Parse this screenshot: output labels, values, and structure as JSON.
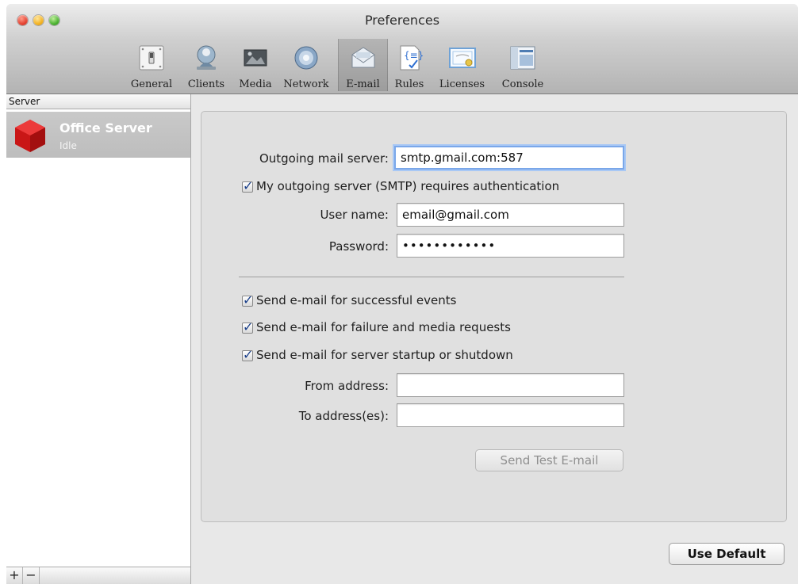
{
  "window": {
    "title": "Preferences"
  },
  "toolbar": {
    "items": [
      {
        "label": "General",
        "icon": "switch-icon"
      },
      {
        "label": "Clients",
        "icon": "globe-user-icon"
      },
      {
        "label": "Media",
        "icon": "media-icon"
      },
      {
        "label": "Network",
        "icon": "network-icon"
      },
      {
        "label": "E-mail",
        "icon": "envelope-icon",
        "active": true
      },
      {
        "label": "Rules",
        "icon": "rules-icon"
      },
      {
        "label": "Licenses",
        "icon": "certificate-icon"
      },
      {
        "label": "Console",
        "icon": "console-icon"
      }
    ]
  },
  "sidebar": {
    "header": "Server",
    "server": {
      "name": "Office Server",
      "status": "Idle",
      "icon": "red-cube-icon"
    },
    "add_label": "+",
    "remove_label": "−"
  },
  "email": {
    "outgoing_label": "Outgoing mail server:",
    "outgoing_value": "smtp.gmail.com:587",
    "auth_label": "My outgoing server (SMTP) requires authentication",
    "auth_checked": true,
    "username_label": "User name:",
    "username_value": "email@gmail.com",
    "password_label": "Password:",
    "password_value": "••••••••••••",
    "send_success_label": "Send e-mail for successful events",
    "send_failure_label": "Send e-mail for failure and media requests",
    "send_startup_label": "Send e-mail for server startup or shutdown",
    "from_label": "From address:",
    "from_value": "",
    "to_label": "To address(es):",
    "to_value": "",
    "test_button": "Send Test E-mail"
  },
  "footer": {
    "default_button": "Use Default"
  },
  "colors": {
    "focus_ring": "#7aa7e9",
    "check": "#1a3f8a",
    "server_icon": "#d11f1f"
  }
}
